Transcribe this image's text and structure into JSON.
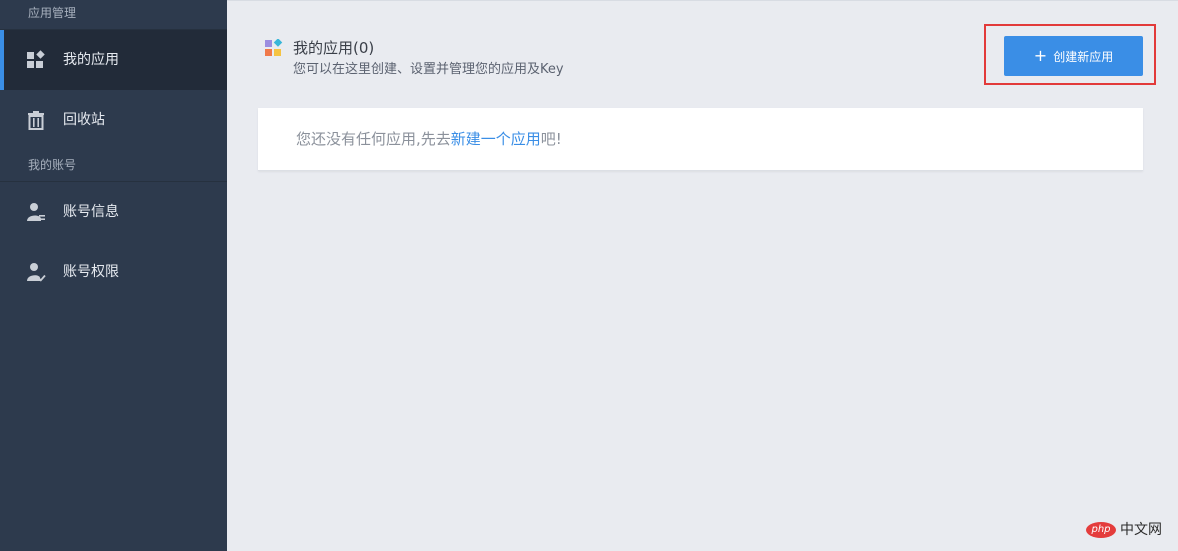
{
  "sidebar": {
    "sections": [
      {
        "title": "应用管理",
        "items": [
          {
            "label": "我的应用",
            "icon": "apps-grid-icon",
            "active": true
          },
          {
            "label": "回收站",
            "icon": "trash-icon",
            "active": false
          }
        ]
      },
      {
        "title": "我的账号",
        "items": [
          {
            "label": "账号信息",
            "icon": "user-info-icon",
            "active": false
          },
          {
            "label": "账号权限",
            "icon": "user-check-icon",
            "active": false
          }
        ]
      }
    ]
  },
  "main": {
    "page_icon": "apps-colorful-icon",
    "title": "我的应用(0)",
    "subtitle": "您可以在这里创建、设置并管理您的应用及Key",
    "create_button": {
      "icon": "plus-icon",
      "label": "创建新应用"
    },
    "empty_state": {
      "prefix": "您还没有任何应用,先去",
      "link": "新建一个应用",
      "suffix": "吧!"
    }
  },
  "watermark": {
    "logo_text": "php",
    "text": "中文网"
  },
  "colors": {
    "sidebar_bg": "#2d3a4d",
    "sidebar_active_bg": "#222b39",
    "accent": "#3a8ee6",
    "highlight_frame": "#e23a3a",
    "page_bg": "#e9ebf0"
  }
}
